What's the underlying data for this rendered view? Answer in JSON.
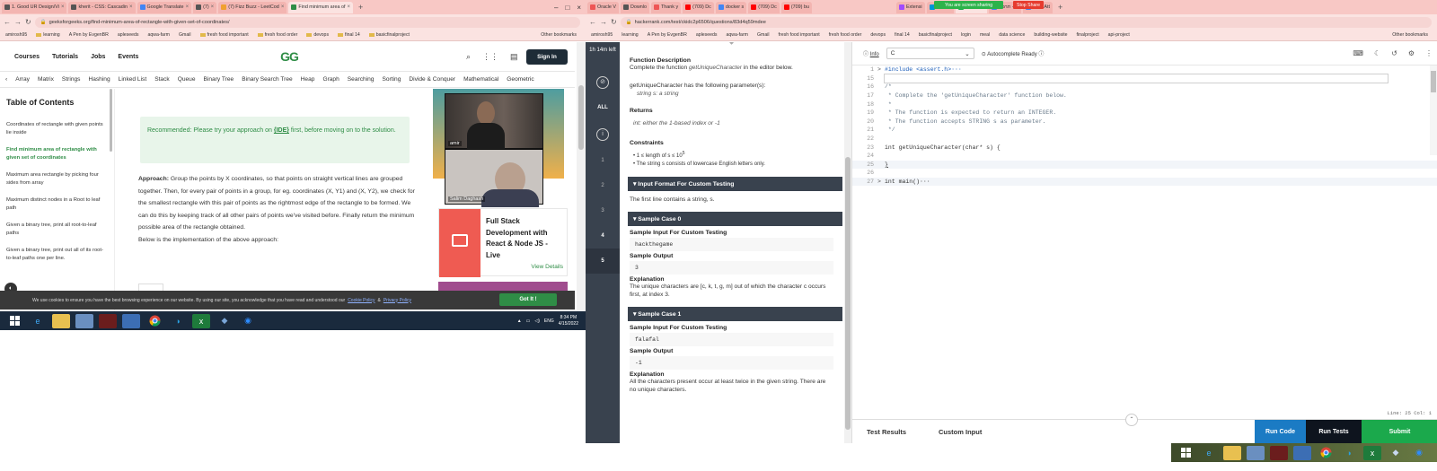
{
  "left_browser": {
    "tabs": [
      {
        "label": "1. Good UR Design/Vi"
      },
      {
        "label": "kherit - CSS: Cascadin"
      },
      {
        "label": "Google Translate"
      },
      {
        "label": "(7)"
      },
      {
        "label": "(7) Fizz Buzz - LeetCod"
      },
      {
        "label": "Find minimum area of"
      }
    ],
    "url": "geeksforgeeks.org/find-minimum-area-of-rectangle-with-given-set-of-coordinates/",
    "bookmarks": [
      "amirosh95",
      "learning",
      "A Pen by EvgenBR",
      "apleseeds",
      "aqwa-farm",
      "Gmail",
      "fresh food important",
      "fresh food order",
      "devops",
      "final 14",
      "basicfinalproject"
    ],
    "other_bookmarks": "Other bookmarks",
    "gfg": {
      "nav": [
        "Courses",
        "Tutorials",
        "Jobs",
        "Events"
      ],
      "logo": "GG",
      "sign_in": "Sign In",
      "topics": [
        "Array",
        "Matrix",
        "Strings",
        "Hashing",
        "Linked List",
        "Stack",
        "Queue",
        "Binary Tree",
        "Binary Search Tree",
        "Heap",
        "Graph",
        "Searching",
        "Sorting",
        "Divide & Conquer",
        "Mathematical",
        "Geometric"
      ],
      "toc_title": "Table of Contents",
      "toc_items": [
        "Coordinates of rectangle with given points lie inside",
        "Find minimum area of rectangle with given set of coordinates",
        "Maximum area rectangle by picking four sides from array",
        "Maximum distinct nodes in a Root to leaf path",
        "Given a binary tree, print all root-to-leaf paths",
        "Given a binary tree, print out all of its root-to-leaf paths one per line."
      ],
      "recommended_prefix": "Recommended: Please try your approach on ",
      "recommended_link": "{IDE}",
      "recommended_suffix": " first, before moving on to the solution.",
      "approach_label": "Approach:",
      "approach_text": " Group the points by X coordinates, so that points on straight vertical lines are grouped together. Then, for every pair of points in a group, for eg. coordinates (X, Y1) and (X, Y2), we check for the smallest rectangle with this pair of points as the rightmost edge of the rectangle to be formed. We can do this by keeping track of all other pairs of points we've visited before. Finally return the minimum possible area of the rectangle obtained.",
      "approach_tail": "Below is the implementation of the above approach:",
      "course_title": "Full Stack Development with React & Node JS - Live",
      "course_link": "View Details",
      "cookie_text": "We use cookies to ensure you have the best browsing experience on our website. By using our site, you acknowledge that you have read and understood our",
      "cookie_policy": "Cookie Policy",
      "cookie_and": "&",
      "privacy_policy": "Privacy Policy",
      "got_it": "Got It !"
    },
    "video": {
      "person1": "amir",
      "person2": "Salim Daghash"
    },
    "taskbar": {
      "lang": "ENG",
      "time": "8:34 PM",
      "date": "4/15/2022"
    }
  },
  "right_browser": {
    "tabs": [
      {
        "label": "Oracle V"
      },
      {
        "label": "Downlo"
      },
      {
        "label": "Thank y"
      },
      {
        "label": "(709) Dc"
      },
      {
        "label": "docker s"
      },
      {
        "label": "(709) Dc"
      },
      {
        "label": "(709) bu"
      },
      {
        "label": "Extensi"
      },
      {
        "label": "HP Inc"
      },
      {
        "label": "HackerR"
      },
      {
        "label": "תרגום - G"
      },
      {
        "label": "Post Att"
      }
    ],
    "sharing_label": "You are screen sharing",
    "stop_share": "Stop Share",
    "url": "hackerrank.com/test/ckidc2p6506/questions/83d4q59mdee",
    "bookmarks": [
      "amirosh95",
      "learning",
      "A Pen by EvgenBR",
      "apleseeds",
      "aqwa-farm",
      "Gmail",
      "fresh food important",
      "fresh food order",
      "devops",
      "final 14",
      "basicfinalproject",
      "login",
      "meal",
      "data science",
      "building-website",
      "finalproject",
      "api-project"
    ],
    "other_bookmarks": "Other bookmarks",
    "sidebar": {
      "time_left": "1h 14m left",
      "all_label": "ALL",
      "questions": [
        "1",
        "2",
        "3",
        "4",
        "5"
      ]
    },
    "problem": {
      "fd_title": "Function Description",
      "fd_text_1": "Complete the function ",
      "fd_fn": "getUniqueCharacter",
      "fd_text_2": " in the editor below.",
      "param_text": "getUniqueCharacter has the following parameter(s):",
      "param_item": "string s:  a string",
      "returns_title": "Returns",
      "returns_text": "int: either the 1-based index or -1",
      "constraints_title": "Constraints",
      "constraint_1": "1 ≤ length of s ≤ 10",
      "constraint_1_exp": "5",
      "constraint_2": "The string s consists of lowercase English letters only.",
      "input_format_title": "▾ Input Format For Custom Testing",
      "input_format_text": "The first line contains a string, s.",
      "sample0_title": "▾ Sample Case 0",
      "sample_input_label": "Sample Input For Custom Testing",
      "sample0_input": "hackthegame",
      "sample_output_label": "Sample Output",
      "sample0_output": "3",
      "explanation_label": "Explanation",
      "sample0_expl": "The unique characters are [c, k, t, g, m] out of which the character c occurs first, at index 3.",
      "sample1_title": "▾ Sample Case 1",
      "sample1_input": "falafal",
      "sample1_output": "-1",
      "sample1_expl": "All the characters present occur at least twice in the given string. There are no unique characters."
    },
    "editor": {
      "info": "Info",
      "language": "C",
      "autocomplete": "Autocomplete Ready",
      "lines": [
        {
          "n": "1",
          "g": ">",
          "c": "#include <assert.h>···"
        },
        {
          "n": "15",
          "g": "",
          "c": ""
        },
        {
          "n": "16",
          "g": "",
          "c": "/*"
        },
        {
          "n": "17",
          "g": "",
          "c": " * Complete the 'getUniqueCharacter' function below."
        },
        {
          "n": "18",
          "g": "",
          "c": " *"
        },
        {
          "n": "19",
          "g": "",
          "c": " * The function is expected to return an INTEGER."
        },
        {
          "n": "20",
          "g": "",
          "c": " * The function accepts STRING s as parameter."
        },
        {
          "n": "21",
          "g": "",
          "c": " */"
        },
        {
          "n": "22",
          "g": "",
          "c": ""
        },
        {
          "n": "23",
          "g": "",
          "c": "int getUniqueCharacter(char* s) {"
        },
        {
          "n": "24",
          "g": "",
          "c": ""
        },
        {
          "n": "25",
          "g": "",
          "c": "}"
        },
        {
          "n": "26",
          "g": "",
          "c": ""
        },
        {
          "n": "27",
          "g": ">",
          "c": "int main()···"
        }
      ],
      "status": "Line: 25 Col: 1",
      "test_results": "Test Results",
      "custom_input": "Custom Input",
      "run_code": "Run Code",
      "run_tests": "Run Tests",
      "submit": "Submit"
    }
  },
  "colors": {
    "gfg_green": "#2f8d46",
    "hr_dark": "#39424e",
    "run_code_blue": "#1b7bc4",
    "submit_green": "#1ba94c",
    "tab_pink": "#f8c8c5"
  }
}
